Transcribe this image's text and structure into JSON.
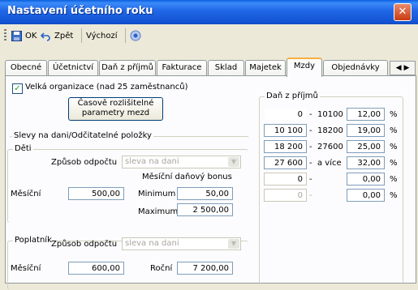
{
  "window": {
    "title": "Nastavení účetního roku"
  },
  "toolbar": {
    "ok_label": "OK",
    "back_label": "Zpět",
    "default_label": "Výchozí",
    "icons": [
      "save-icon",
      "undo-icon",
      "help-icon"
    ]
  },
  "tabs": [
    "Obecné",
    "Účetnictví",
    "Daň z příjmů",
    "Fakturace",
    "Sklad",
    "Majetek",
    "Mzdy",
    "Objednávky"
  ],
  "active_tab": "Mzdy",
  "mzdy": {
    "big_org_label": "Velká organizace (nad 25 zaměstnanců)",
    "big_org_checked": true,
    "time_button": {
      "line1": "Časově rozlišitelné",
      "line2": "parametry mezd"
    },
    "slevy_title": "Slevy na dani/Odčitatelné položky",
    "deti": {
      "title": "Děti",
      "method_label": "Způsob odpočtu",
      "method_value": "sleva na dani",
      "monthly_label": "Měsíční",
      "monthly_value": "500,00",
      "bonus_title": "Měsíční daňový bonus",
      "min_label": "Minimum",
      "min_value": "50,00",
      "max_label": "Maximum",
      "max_value": "2 500,00"
    },
    "poplatnik": {
      "title": "Poplatník",
      "method_label": "Způsob odpočtu",
      "method_value": "sleva na dani",
      "monthly_label": "Měsíční",
      "monthly_value": "600,00",
      "yearly_label": "Roční",
      "yearly_value": "7 200,00"
    },
    "dan_title": "Daň z příjmů",
    "percent": "%",
    "dash": "-",
    "brackets": [
      {
        "from": "0",
        "to": "10100",
        "rate": "12,00"
      },
      {
        "from": "10 100",
        "to": "18200",
        "rate": "19,00"
      },
      {
        "from": "18 200",
        "to": "27600",
        "rate": "25,00"
      },
      {
        "from": "27 600",
        "to": "a více",
        "rate": "32,00"
      },
      {
        "from": "0",
        "to": "",
        "rate": "0,00"
      },
      {
        "from": "0",
        "to": "",
        "rate": "0,00"
      }
    ]
  }
}
